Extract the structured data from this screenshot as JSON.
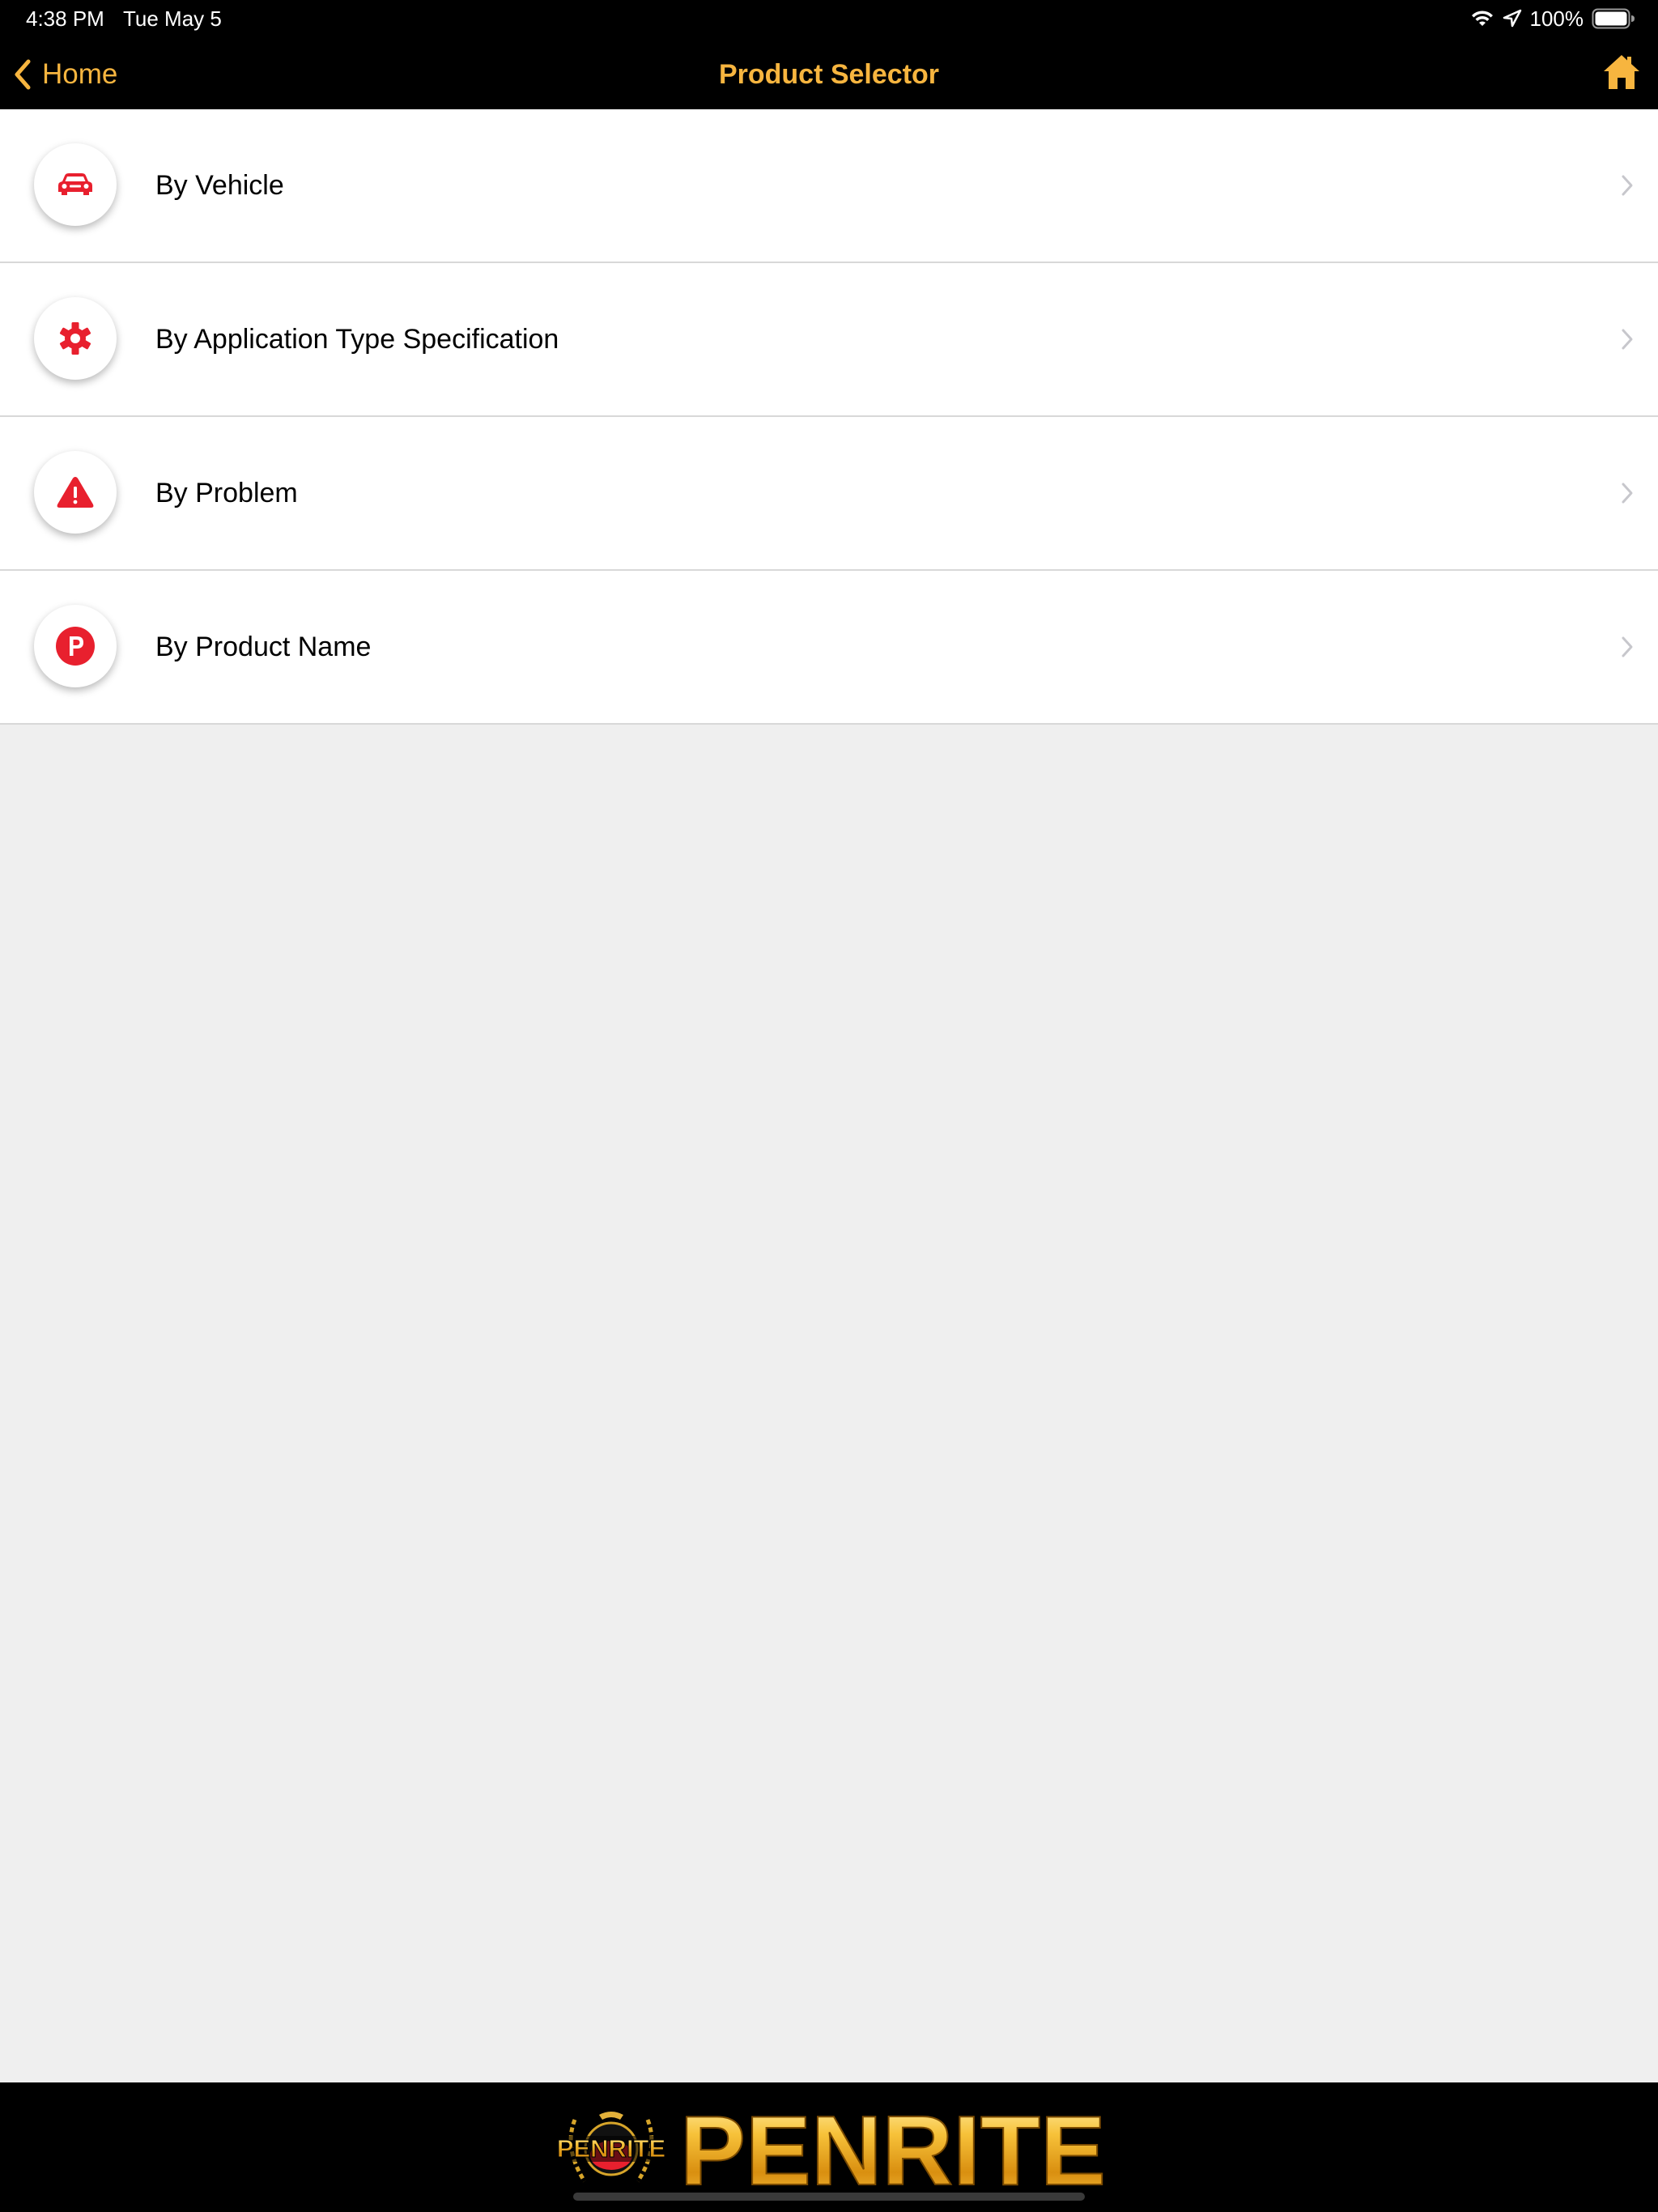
{
  "status_bar": {
    "time": "4:38 PM",
    "date": "Tue May 5",
    "battery_percent": "100%",
    "icons": [
      "wifi-icon",
      "location-icon",
      "battery-icon"
    ]
  },
  "nav_bar": {
    "back_label": "Home",
    "title": "Product Selector",
    "home_icon": "home-icon"
  },
  "menu": {
    "items": [
      {
        "label": "By Vehicle",
        "icon": "car-icon"
      },
      {
        "label": "By Application Type Specification",
        "icon": "gear-icon"
      },
      {
        "label": "By Problem",
        "icon": "warning-icon"
      },
      {
        "label": "By Product Name",
        "icon": "product-p-icon"
      }
    ]
  },
  "footer": {
    "brand_wordmark": "PENRITE",
    "badge_text": "PENRITE"
  },
  "colors": {
    "accent": "#f7b53f",
    "icon_red": "#e8202e",
    "bar_background": "#000000",
    "page_background": "#efefef"
  }
}
